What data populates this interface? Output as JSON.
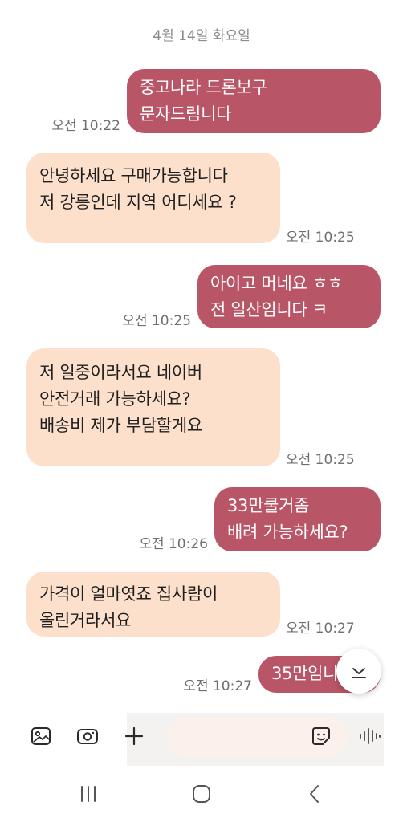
{
  "conversation": {
    "date_header": "4월 14일 화요일",
    "messages": [
      {
        "direction": "outgoing",
        "text": "중고나라  드론보구\n문자드림니다",
        "time": "오전 10:22"
      },
      {
        "direction": "incoming",
        "text": "안녕하세요 구매가능합니다\n저 강릉인데 지역 어디세요 ?",
        "time": "오전 10:25"
      },
      {
        "direction": "outgoing",
        "text": "아이고  머네요 ㅎㅎ\n전 일산임니다 ㅋ",
        "time": "오전 10:25"
      },
      {
        "direction": "incoming",
        "text": "저 일중이라서요 네이버\n안전거래 가능하세요?\n배송비 제가 부담할게요",
        "time": "오전 10:25"
      },
      {
        "direction": "outgoing",
        "text": "33만쿨거좀\n배려 가능하세요?",
        "time": "오전 10:26"
      },
      {
        "direction": "incoming",
        "text": "가격이 얼마엿죠 집사람이\n올린거라서요",
        "time": "오전 10:27"
      },
      {
        "direction": "outgoing",
        "text": "35만임니",
        "time": "오전 10:27"
      }
    ]
  },
  "composer": {
    "gallery_icon": "image-icon",
    "camera_icon": "camera-icon",
    "add_icon": "plus-icon",
    "emoji_icon": "emoji-sticker-icon",
    "voice_icon": "voice-waveform-icon"
  },
  "navigation": {
    "recent_icon": "recent-apps-icon",
    "home_icon": "home-icon",
    "back_icon": "back-icon"
  },
  "colors": {
    "outgoing_bubble": "#b85567",
    "incoming_bubble": "#fde0cc",
    "timestamp": "#6f6f6f"
  }
}
